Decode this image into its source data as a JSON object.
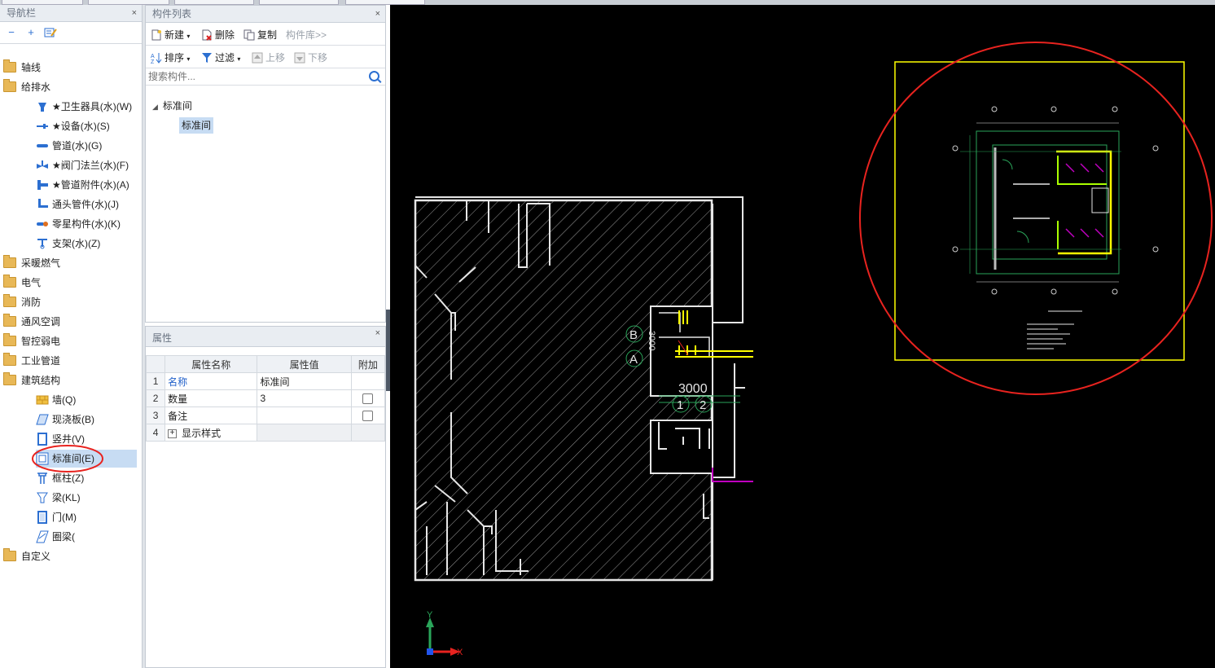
{
  "nav_panel": {
    "title": "导航栏",
    "close": "×",
    "tools": [
      "collapse-all",
      "expand-all",
      "edit"
    ],
    "items": [
      {
        "label": "轴线",
        "level": 0,
        "kind": "folder"
      },
      {
        "label": "给排水",
        "level": 0,
        "kind": "folder-open"
      },
      {
        "label": "★卫生器具(水)(W)",
        "level": 1,
        "icon": "sanitary-icon"
      },
      {
        "label": "★设备(水)(S)",
        "level": 1,
        "icon": "equipment-icon"
      },
      {
        "label": "管道(水)(G)",
        "level": 1,
        "icon": "pipe-icon"
      },
      {
        "label": "★阀门法兰(水)(F)",
        "level": 1,
        "icon": "valve-icon"
      },
      {
        "label": "★管道附件(水)(A)",
        "level": 1,
        "icon": "pipe-fitting-icon"
      },
      {
        "label": "通头管件(水)(J)",
        "level": 1,
        "icon": "connector-icon"
      },
      {
        "label": "零星构件(水)(K)",
        "level": 1,
        "icon": "misc-component-icon"
      },
      {
        "label": "支架(水)(Z)",
        "level": 1,
        "icon": "bracket-icon"
      },
      {
        "label": "采暖燃气",
        "level": 0,
        "kind": "folder"
      },
      {
        "label": "电气",
        "level": 0,
        "kind": "folder"
      },
      {
        "label": "消防",
        "level": 0,
        "kind": "folder"
      },
      {
        "label": "通风空调",
        "level": 0,
        "kind": "folder"
      },
      {
        "label": "智控弱电",
        "level": 0,
        "kind": "folder"
      },
      {
        "label": "工业管道",
        "level": 0,
        "kind": "folder"
      },
      {
        "label": "建筑结构",
        "level": 0,
        "kind": "folder-open"
      },
      {
        "label": "墙(Q)",
        "level": 1,
        "icon": "wall-icon"
      },
      {
        "label": "现浇板(B)",
        "level": 1,
        "icon": "slab-icon"
      },
      {
        "label": "竖井(V)",
        "level": 1,
        "icon": "shaft-icon"
      },
      {
        "label": "标准间(E)",
        "level": 1,
        "icon": "standard-room-icon",
        "selected": true
      },
      {
        "label": "框柱(Z)",
        "level": 1,
        "icon": "column-icon"
      },
      {
        "label": "梁(KL)",
        "level": 1,
        "icon": "beam-icon"
      },
      {
        "label": "门(M)",
        "level": 1,
        "icon": "door-icon"
      },
      {
        "label": "圈梁(",
        "level": 1,
        "icon": "ring-beam-icon"
      },
      {
        "label": "自定义",
        "level": 0,
        "kind": "folder"
      }
    ]
  },
  "component_list": {
    "title": "构件列表",
    "close": "×",
    "toolbar1": {
      "new": "新建",
      "delete": "删除",
      "copy": "复制",
      "library": "构件库>>"
    },
    "toolbar2": {
      "sort": "排序",
      "filter": "过滤",
      "up": "上移",
      "down": "下移"
    },
    "search_placeholder": "搜索构件...",
    "tree": {
      "root": "标准间",
      "child": "标准间"
    }
  },
  "properties": {
    "title": "属性",
    "close": "×",
    "headers": [
      "属性名称",
      "属性值",
      "附加"
    ],
    "rows": [
      {
        "num": "1",
        "name": "名称",
        "value": "标准间",
        "check": false
      },
      {
        "num": "2",
        "name": "数量",
        "value": "3",
        "check": true
      },
      {
        "num": "3",
        "name": "备注",
        "value": "",
        "check": true
      },
      {
        "num": "4",
        "name": "显示样式",
        "value": "",
        "check": false
      }
    ]
  },
  "canvas": {
    "grid_labels": {
      "b": "B",
      "a": "A",
      "one": "1",
      "two": "2"
    },
    "dimension": "3000",
    "dim_vertical": "3000",
    "axis_x": "X",
    "axis_y": "Y",
    "colors": {
      "background": "#000000",
      "lines": "#e6e6e6",
      "yellow": "#ffff00",
      "red": "#e8231f",
      "green": "#2aa55a",
      "magenta": "#c000c0"
    }
  }
}
